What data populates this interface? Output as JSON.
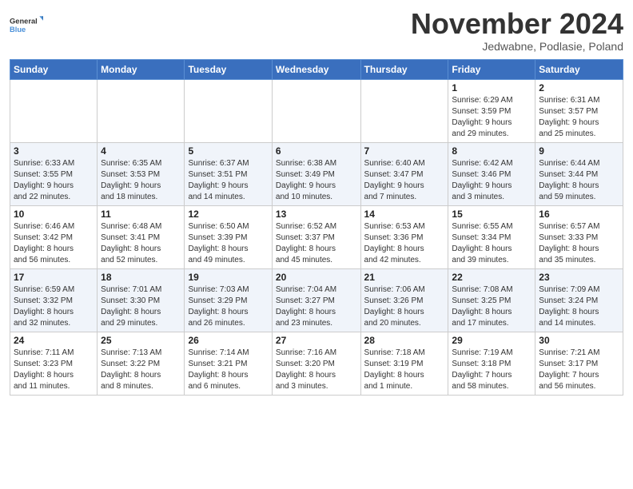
{
  "logo": {
    "line1": "General",
    "line2": "Blue"
  },
  "title": "November 2024",
  "subtitle": "Jedwabne, Podlasie, Poland",
  "days_header": [
    "Sunday",
    "Monday",
    "Tuesday",
    "Wednesday",
    "Thursday",
    "Friday",
    "Saturday"
  ],
  "weeks": [
    [
      {
        "day": "",
        "info": ""
      },
      {
        "day": "",
        "info": ""
      },
      {
        "day": "",
        "info": ""
      },
      {
        "day": "",
        "info": ""
      },
      {
        "day": "",
        "info": ""
      },
      {
        "day": "1",
        "info": "Sunrise: 6:29 AM\nSunset: 3:59 PM\nDaylight: 9 hours\nand 29 minutes."
      },
      {
        "day": "2",
        "info": "Sunrise: 6:31 AM\nSunset: 3:57 PM\nDaylight: 9 hours\nand 25 minutes."
      }
    ],
    [
      {
        "day": "3",
        "info": "Sunrise: 6:33 AM\nSunset: 3:55 PM\nDaylight: 9 hours\nand 22 minutes."
      },
      {
        "day": "4",
        "info": "Sunrise: 6:35 AM\nSunset: 3:53 PM\nDaylight: 9 hours\nand 18 minutes."
      },
      {
        "day": "5",
        "info": "Sunrise: 6:37 AM\nSunset: 3:51 PM\nDaylight: 9 hours\nand 14 minutes."
      },
      {
        "day": "6",
        "info": "Sunrise: 6:38 AM\nSunset: 3:49 PM\nDaylight: 9 hours\nand 10 minutes."
      },
      {
        "day": "7",
        "info": "Sunrise: 6:40 AM\nSunset: 3:47 PM\nDaylight: 9 hours\nand 7 minutes."
      },
      {
        "day": "8",
        "info": "Sunrise: 6:42 AM\nSunset: 3:46 PM\nDaylight: 9 hours\nand 3 minutes."
      },
      {
        "day": "9",
        "info": "Sunrise: 6:44 AM\nSunset: 3:44 PM\nDaylight: 8 hours\nand 59 minutes."
      }
    ],
    [
      {
        "day": "10",
        "info": "Sunrise: 6:46 AM\nSunset: 3:42 PM\nDaylight: 8 hours\nand 56 minutes."
      },
      {
        "day": "11",
        "info": "Sunrise: 6:48 AM\nSunset: 3:41 PM\nDaylight: 8 hours\nand 52 minutes."
      },
      {
        "day": "12",
        "info": "Sunrise: 6:50 AM\nSunset: 3:39 PM\nDaylight: 8 hours\nand 49 minutes."
      },
      {
        "day": "13",
        "info": "Sunrise: 6:52 AM\nSunset: 3:37 PM\nDaylight: 8 hours\nand 45 minutes."
      },
      {
        "day": "14",
        "info": "Sunrise: 6:53 AM\nSunset: 3:36 PM\nDaylight: 8 hours\nand 42 minutes."
      },
      {
        "day": "15",
        "info": "Sunrise: 6:55 AM\nSunset: 3:34 PM\nDaylight: 8 hours\nand 39 minutes."
      },
      {
        "day": "16",
        "info": "Sunrise: 6:57 AM\nSunset: 3:33 PM\nDaylight: 8 hours\nand 35 minutes."
      }
    ],
    [
      {
        "day": "17",
        "info": "Sunrise: 6:59 AM\nSunset: 3:32 PM\nDaylight: 8 hours\nand 32 minutes."
      },
      {
        "day": "18",
        "info": "Sunrise: 7:01 AM\nSunset: 3:30 PM\nDaylight: 8 hours\nand 29 minutes."
      },
      {
        "day": "19",
        "info": "Sunrise: 7:03 AM\nSunset: 3:29 PM\nDaylight: 8 hours\nand 26 minutes."
      },
      {
        "day": "20",
        "info": "Sunrise: 7:04 AM\nSunset: 3:27 PM\nDaylight: 8 hours\nand 23 minutes."
      },
      {
        "day": "21",
        "info": "Sunrise: 7:06 AM\nSunset: 3:26 PM\nDaylight: 8 hours\nand 20 minutes."
      },
      {
        "day": "22",
        "info": "Sunrise: 7:08 AM\nSunset: 3:25 PM\nDaylight: 8 hours\nand 17 minutes."
      },
      {
        "day": "23",
        "info": "Sunrise: 7:09 AM\nSunset: 3:24 PM\nDaylight: 8 hours\nand 14 minutes."
      }
    ],
    [
      {
        "day": "24",
        "info": "Sunrise: 7:11 AM\nSunset: 3:23 PM\nDaylight: 8 hours\nand 11 minutes."
      },
      {
        "day": "25",
        "info": "Sunrise: 7:13 AM\nSunset: 3:22 PM\nDaylight: 8 hours\nand 8 minutes."
      },
      {
        "day": "26",
        "info": "Sunrise: 7:14 AM\nSunset: 3:21 PM\nDaylight: 8 hours\nand 6 minutes."
      },
      {
        "day": "27",
        "info": "Sunrise: 7:16 AM\nSunset: 3:20 PM\nDaylight: 8 hours\nand 3 minutes."
      },
      {
        "day": "28",
        "info": "Sunrise: 7:18 AM\nSunset: 3:19 PM\nDaylight: 8 hours\nand 1 minute."
      },
      {
        "day": "29",
        "info": "Sunrise: 7:19 AM\nSunset: 3:18 PM\nDaylight: 7 hours\nand 58 minutes."
      },
      {
        "day": "30",
        "info": "Sunrise: 7:21 AM\nSunset: 3:17 PM\nDaylight: 7 hours\nand 56 minutes."
      }
    ]
  ]
}
